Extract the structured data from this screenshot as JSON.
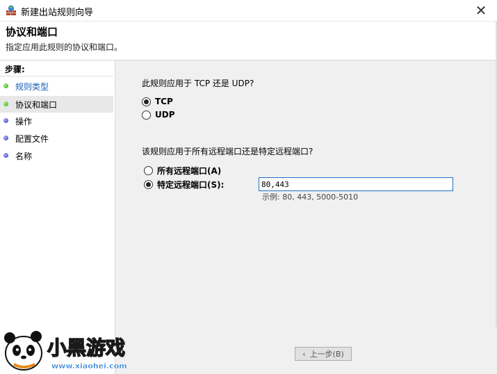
{
  "window": {
    "title": "新建出站规则向导",
    "close_glyph": "✕"
  },
  "header": {
    "title": "协议和端口",
    "subtitle": "指定应用此规则的协议和端口。"
  },
  "sidebar": {
    "heading": "步骤:",
    "items": [
      {
        "label": "规则类型",
        "state": "done"
      },
      {
        "label": "协议和端口",
        "state": "current"
      },
      {
        "label": "操作",
        "state": "pending"
      },
      {
        "label": "配置文件",
        "state": "pending"
      },
      {
        "label": "名称",
        "state": "pending"
      }
    ]
  },
  "protocol": {
    "question": "此规则应用于 TCP 还是 UDP?",
    "options": [
      {
        "label": "TCP",
        "selected": true
      },
      {
        "label": "UDP",
        "selected": false
      }
    ]
  },
  "ports": {
    "question": "该规则应用于所有远程端口还是特定远程端口?",
    "options": [
      {
        "label": "所有远程端口(A)",
        "selected": false
      },
      {
        "label": "特定远程端口(S):",
        "selected": true
      }
    ],
    "value": "80,443",
    "example": "示例: 80, 443, 5000-5010"
  },
  "buttons": {
    "back": "上一步(B)"
  },
  "watermark": {
    "brand": "小黑游戏",
    "url": "www.xiaohei.com"
  },
  "colors": {
    "accent": "#1f6fc5",
    "content_bg": "#f0f0f0",
    "link": "#1a5fb4"
  }
}
